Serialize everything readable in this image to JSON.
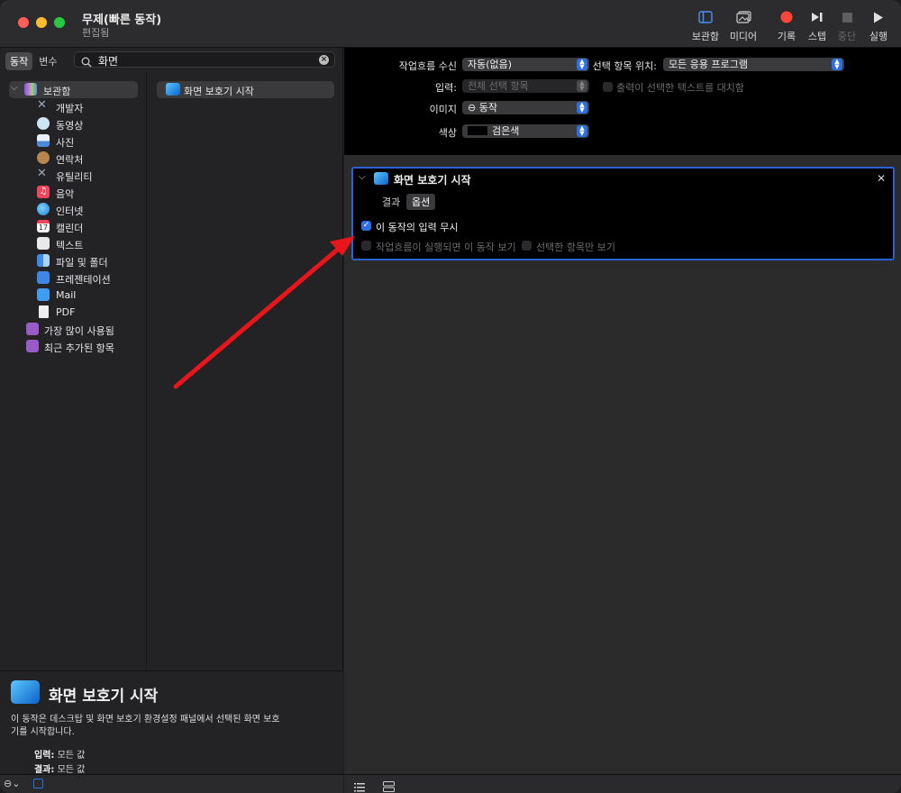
{
  "window": {
    "title": "무제(빠른 동작)",
    "subtitle": "편집됨"
  },
  "toolbar": [
    {
      "label": "보관함",
      "icon": "library-icon",
      "enabled": true
    },
    {
      "label": "미디어",
      "icon": "media-icon",
      "enabled": true
    },
    {
      "label": "기록",
      "icon": "record-icon",
      "enabled": true
    },
    {
      "label": "스텝",
      "icon": "step-icon",
      "enabled": true
    },
    {
      "label": "중단",
      "icon": "stop-icon",
      "enabled": false
    },
    {
      "label": "실행",
      "icon": "run-icon",
      "enabled": true
    }
  ],
  "left": {
    "tabs": [
      "동작",
      "변수"
    ],
    "search": {
      "value": "화면"
    },
    "library": [
      {
        "label": "보관함",
        "icon": "library-icon",
        "color": "#8e6bd9"
      },
      {
        "label": "개발자",
        "icon": "developer-icon",
        "color": "#9aa8b8"
      },
      {
        "label": "동영상",
        "icon": "movie-icon",
        "color": "#5fa8e8"
      },
      {
        "label": "사진",
        "icon": "photos-icon",
        "color": "#4b8ad6"
      },
      {
        "label": "연락처",
        "icon": "contacts-icon",
        "color": "#b8864b"
      },
      {
        "label": "유틸리티",
        "icon": "utilities-icon",
        "color": "#9aa8b8"
      },
      {
        "label": "음악",
        "icon": "music-icon",
        "color": "#f0455a"
      },
      {
        "label": "인터넷",
        "icon": "internet-icon",
        "color": "#2da3e0"
      },
      {
        "label": "캘린더",
        "icon": "calendar-icon",
        "color": "#f5f5f5"
      },
      {
        "label": "텍스트",
        "icon": "text-icon",
        "color": "#e8e8e8"
      },
      {
        "label": "파일 및 폴더",
        "icon": "finder-icon",
        "color": "#3d8de8"
      },
      {
        "label": "프레젠테이션",
        "icon": "presentation-icon",
        "color": "#3f87e6"
      },
      {
        "label": "Mail",
        "icon": "mail-icon",
        "color": "#3e9cf2"
      },
      {
        "label": "PDF",
        "icon": "pdf-icon",
        "color": "#eeeeee"
      },
      {
        "label": "가장 많이 사용됨",
        "icon": "smart-folder-icon",
        "color": "#9a5bc8"
      },
      {
        "label": "최근 추가된 항목",
        "icon": "smart-folder-icon",
        "color": "#9a5bc8"
      }
    ],
    "actions": [
      {
        "label": "화면 보호기 시작"
      }
    ],
    "description": {
      "title": "화면 보호기 시작",
      "text": "이 동작은 데스크탑 및 화면 보호기 환경설정 패널에서 선택된 화면 보호기를 시작합니다.",
      "input_key": "입력:",
      "input_value": "모든 값",
      "result_key": "결과:",
      "result_value": "모든 값"
    }
  },
  "workflow": {
    "receives_label": "작업흐름 수신",
    "receives_value": "자동(없음)",
    "in_label": "선택 항목 위치:",
    "in_value": "모든 응용 프로그램",
    "input_label": "입력:",
    "input_value": "전체 선택 항목",
    "replace_label": "출력이 선택한 텍스트를 대치함",
    "image_label": "이미지",
    "image_value": "⊖ 동작",
    "color_label": "색상",
    "color_value": "검은색",
    "color_swatch": "#000000"
  },
  "card": {
    "title": "화면 보호기 시작",
    "tabs": [
      "결과",
      "옵션"
    ],
    "ignore_input": "이 동작의 입력 무시",
    "show_when_run": "작업흐름이 실행되면 이 동작 보기",
    "show_selected": "선택한 항목만 보기"
  },
  "colors": {
    "accent": "#2f6fe4",
    "arrow": "#e8151b"
  }
}
